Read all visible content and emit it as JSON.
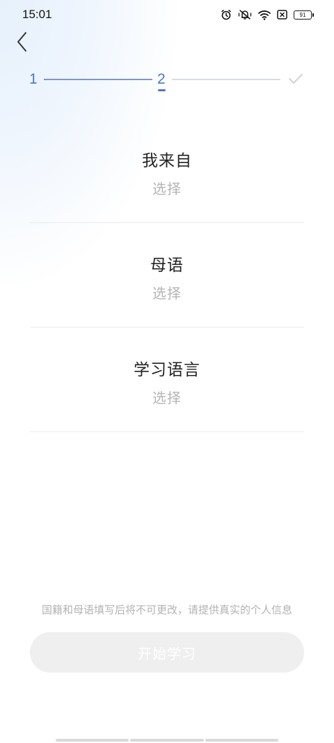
{
  "status_bar": {
    "time": "15:01",
    "battery_level": "91",
    "icons": [
      "alarm-icon",
      "mute-vibrate-icon",
      "wifi-icon",
      "sim-off-icon",
      "battery-icon"
    ]
  },
  "nav": {
    "back_icon": "chevron-left-icon"
  },
  "stepper": {
    "step1": "1",
    "step2": "2",
    "step3_icon": "checkmark-icon",
    "current_step": 2,
    "active_color": "#4a78c8"
  },
  "fields": [
    {
      "title": "我来自",
      "value": "选择"
    },
    {
      "title": "母语",
      "value": "选择"
    },
    {
      "title": "学习语言",
      "value": "选择"
    }
  ],
  "notice": "国籍和母语填写后将不可更改，请提供真实的个人信息",
  "start_button": {
    "label": "开始学习",
    "enabled": false
  }
}
